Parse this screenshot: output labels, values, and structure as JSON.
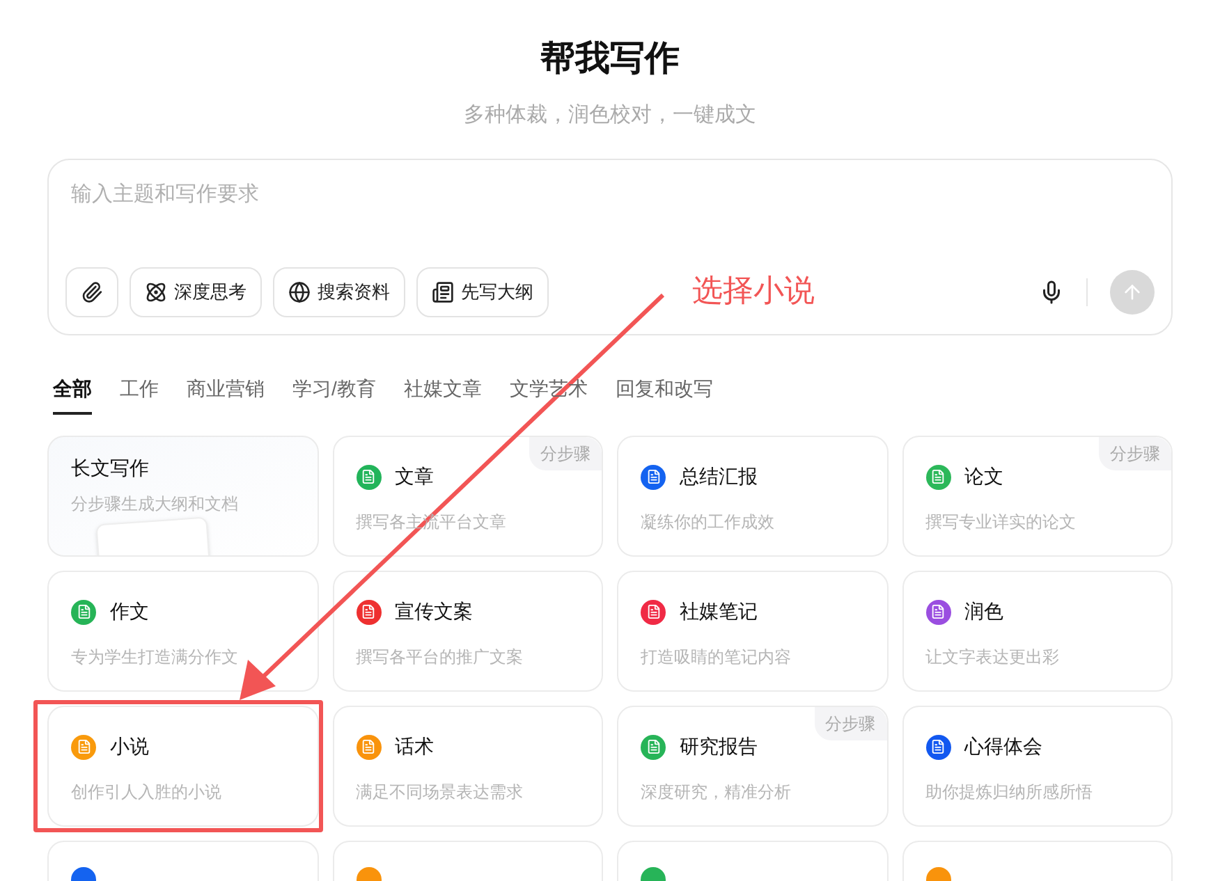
{
  "header": {
    "title": "帮我写作",
    "subtitle": "多种体裁，润色校对，一键成文"
  },
  "composer": {
    "placeholder": "输入主题和写作要求",
    "tools": [
      {
        "kind": "attach"
      },
      {
        "kind": "think",
        "label": "深度思考"
      },
      {
        "kind": "search",
        "label": "搜索资料"
      },
      {
        "kind": "outline",
        "label": "先写大纲"
      }
    ]
  },
  "tabs": [
    {
      "label": "全部",
      "selected": true
    },
    {
      "label": "工作",
      "selected": false
    },
    {
      "label": "商业营销",
      "selected": false
    },
    {
      "label": "学习/教育",
      "selected": false
    },
    {
      "label": "社媒文章",
      "selected": false
    },
    {
      "label": "文学艺术",
      "selected": false
    },
    {
      "label": "回复和改写",
      "selected": false
    }
  ],
  "cards": [
    {
      "kind": "feature",
      "title": "长文写作",
      "desc": "分步骤生成大纲和文档",
      "highlighted": false
    },
    {
      "kind": "tool",
      "title": "文章",
      "desc": "撰写各主流平台文章",
      "color": "#22b45a",
      "badge": "分步骤",
      "highlighted": false
    },
    {
      "kind": "tool",
      "title": "总结汇报",
      "desc": "凝练你的工作成效",
      "color": "#1463f0",
      "highlighted": false
    },
    {
      "kind": "tool",
      "title": "论文",
      "desc": "撰写专业详实的论文",
      "color": "#2cb85a",
      "badge": "分步骤",
      "highlighted": false
    },
    {
      "kind": "tool",
      "title": "作文",
      "desc": "专为学生打造满分作文",
      "color": "#26b457",
      "highlighted": false
    },
    {
      "kind": "tool",
      "title": "宣传文案",
      "desc": "撰写各平台的推广文案",
      "color": "#ee3030",
      "highlighted": false
    },
    {
      "kind": "tool",
      "title": "社媒笔记",
      "desc": "打造吸睛的笔记内容",
      "color": "#f02a45",
      "highlighted": false
    },
    {
      "kind": "tool",
      "title": "润色",
      "desc": "让文字表达更出彩",
      "color": "#9a4ee0",
      "highlighted": false
    },
    {
      "kind": "tool",
      "title": "小说",
      "desc": "创作引人入胜的小说",
      "color": "#f99a0c",
      "highlighted": true
    },
    {
      "kind": "tool",
      "title": "话术",
      "desc": "满足不同场景表达需求",
      "color": "#f9930c",
      "highlighted": false
    },
    {
      "kind": "tool",
      "title": "研究报告",
      "desc": "深度研究，精准分析",
      "color": "#27b458",
      "badge": "分步骤",
      "highlighted": false
    },
    {
      "kind": "tool",
      "title": "心得体会",
      "desc": "助你提炼归纳所感所悟",
      "color": "#1258f0",
      "highlighted": false
    },
    {
      "kind": "partial",
      "color": "#1463f0",
      "highlighted": false
    },
    {
      "kind": "partial",
      "color": "#f9930c",
      "highlighted": false
    },
    {
      "kind": "partial",
      "color": "#27b458",
      "highlighted": false
    },
    {
      "kind": "partial",
      "color": "#f9930c",
      "highlighted": false
    }
  ],
  "annotation": {
    "text": "选择小说"
  }
}
